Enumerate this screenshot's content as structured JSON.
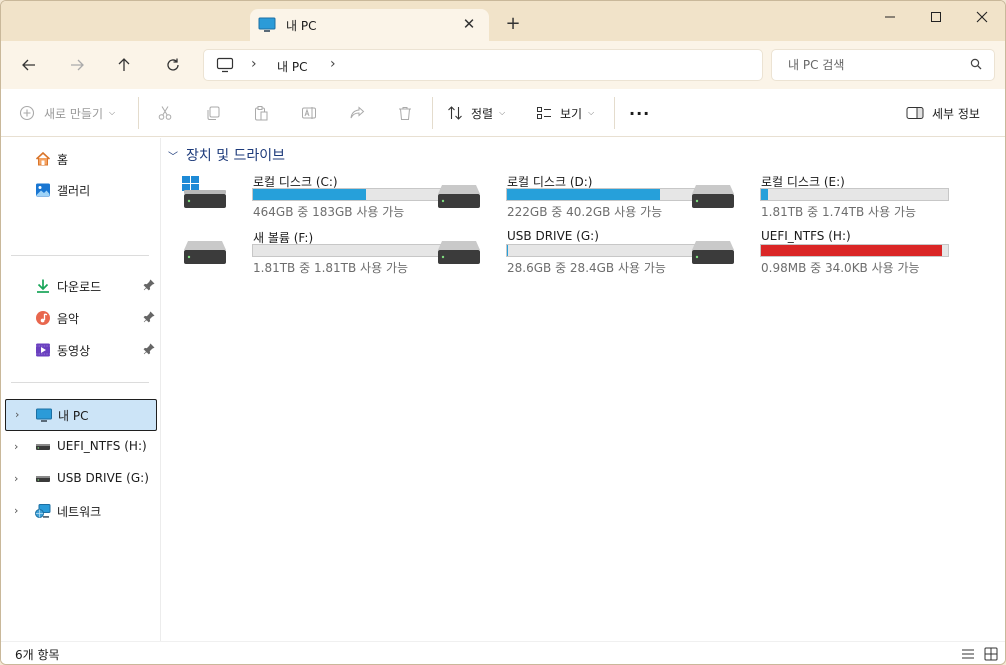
{
  "tab": {
    "title": "내 PC",
    "close": "✕",
    "new_tab": "+"
  },
  "window_controls": {
    "minimize": "minimize-icon",
    "maximize": "maximize-icon",
    "close": "close-icon"
  },
  "address": {
    "segment": "내 PC",
    "separator": "›"
  },
  "search": {
    "placeholder": "내 PC 검색"
  },
  "toolbar": {
    "new": "새로 만들기",
    "sort": "정렬",
    "view": "보기",
    "more": "···",
    "details": "세부 정보"
  },
  "sidebar": {
    "quick": [
      {
        "label": "홈",
        "icon": "home-icon"
      },
      {
        "label": "갤러리",
        "icon": "gallery-icon"
      }
    ],
    "pinned": [
      {
        "label": "다운로드",
        "icon": "download-icon"
      },
      {
        "label": "음악",
        "icon": "music-icon"
      },
      {
        "label": "동영상",
        "icon": "video-icon"
      }
    ],
    "tree": [
      {
        "label": "내 PC",
        "icon": "pc-icon",
        "selected": true
      },
      {
        "label": "UEFI_NTFS (H:)",
        "icon": "drive-icon"
      },
      {
        "label": "USB DRIVE (G:)",
        "icon": "drive-icon"
      },
      {
        "label": "네트워크",
        "icon": "network-icon"
      }
    ]
  },
  "content": {
    "group_title": "장치 및 드라이브",
    "drives": [
      {
        "name": "로컬 디스크 (C:)",
        "space": "464GB 중 183GB 사용 가능",
        "used": 0.606,
        "windows": true
      },
      {
        "name": "로컬 디스크 (D:)",
        "space": "222GB 중 40.2GB 사용 가능",
        "used": 0.819
      },
      {
        "name": "로컬 디스크 (E:)",
        "space": "1.81TB 중 1.74TB 사용 가능",
        "used": 0.039
      },
      {
        "name": "새 볼륨 (F:)",
        "space": "1.81TB 중 1.81TB 사용 가능",
        "used": 0.0
      },
      {
        "name": "USB DRIVE (G:)",
        "space": "28.6GB 중 28.4GB 사용 가능",
        "used": 0.007
      },
      {
        "name": "UEFI_NTFS (H:)",
        "space": "0.98MB 중 34.0KB 사용 가능",
        "used": 0.966,
        "full": true
      }
    ]
  },
  "status": {
    "item_count": "6개 항목"
  },
  "colors": {
    "accent": "#26a0da",
    "full": "#da2626",
    "selected_bg": "#cce4f7",
    "title_bg": "#f1e3c9"
  }
}
